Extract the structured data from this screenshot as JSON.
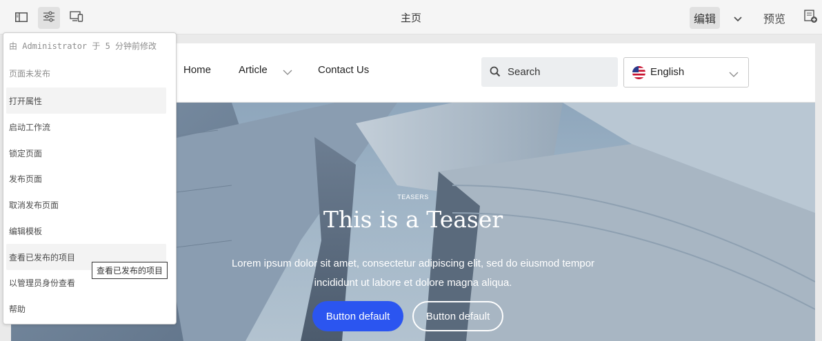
{
  "toolbar": {
    "page_title": "主页",
    "mode_label": "编辑",
    "preview_label": "预览"
  },
  "popover": {
    "info": "由 Administrator 于 5 分钟前修改",
    "status": "页面未发布",
    "items": [
      {
        "label": "打开属性"
      },
      {
        "label": "启动工作流"
      },
      {
        "label": "锁定页面"
      },
      {
        "label": "发布页面"
      },
      {
        "label": "取消发布页面"
      },
      {
        "label": "编辑模板"
      },
      {
        "label": "查看已发布的项目"
      },
      {
        "label": "以管理员身份查看"
      },
      {
        "label": "帮助"
      }
    ],
    "tooltip": "查看已发布的项目"
  },
  "site": {
    "nav": [
      "Home",
      "Article",
      "Contact Us"
    ],
    "search_placeholder": "Search",
    "language": "English"
  },
  "teaser": {
    "pretitle": "TEASERS",
    "title": "This is a Teaser",
    "description": "Lorem ipsum dolor sit amet, consectetur adipiscing elit, sed do eiusmod tempor incididunt ut labore et dolore magna aliqua.",
    "button_primary": "Button default",
    "button_secondary": "Button default"
  },
  "colors": {
    "accent": "#2b55f0",
    "toolbar_bg": "#f5f5f5"
  }
}
